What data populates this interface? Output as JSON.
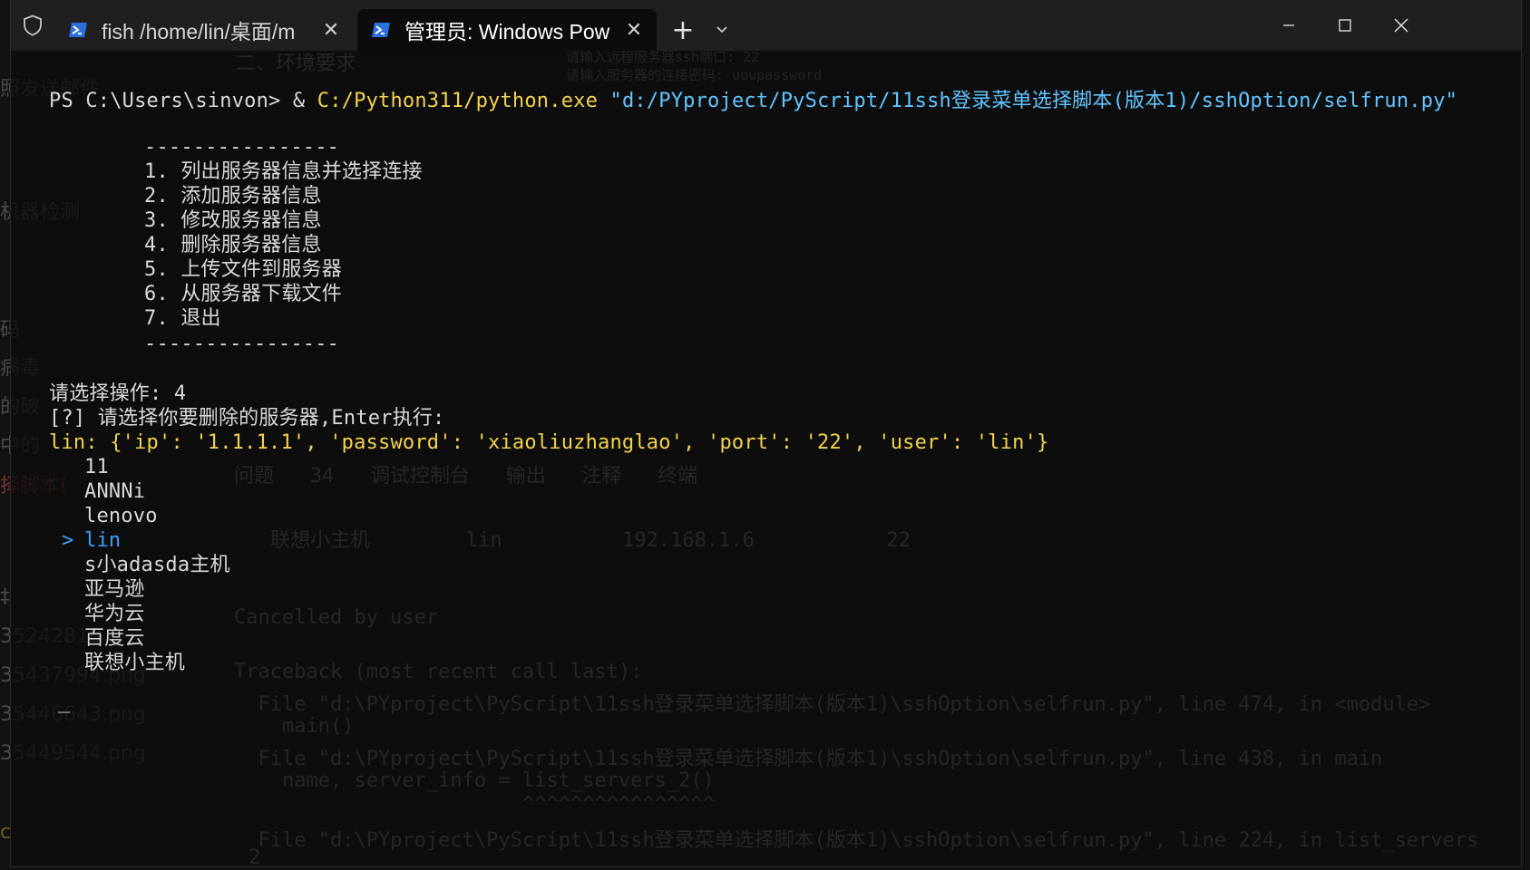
{
  "tabs": [
    {
      "title": "fish /home/lin/桌面/m",
      "icon": "powershell-icon",
      "active": false
    },
    {
      "title": "管理员: Windows Pow",
      "icon": "powershell-icon",
      "active": true
    }
  ],
  "titlebar": {
    "new_tab": "+",
    "close_glyph": "✕"
  },
  "terminal": {
    "prompt": "PS C:\\Users\\sinvon> & ",
    "exe": "C:/Python311/python.exe",
    "script": "\"d:/PYproject/PyScript/11ssh登录菜单选择脚本(版本1)/sshOption/selfrun.py\"",
    "separator": "----------------",
    "menu": [
      "1. 列出服务器信息并选择连接",
      "2. 添加服务器信息",
      "3. 修改服务器信息",
      "4. 删除服务器信息",
      "5. 上传文件到服务器",
      "6. 从服务器下载文件",
      "7. 退出"
    ],
    "choose_prompt": "请选择操作: 4",
    "delete_prompt": "[?] 请选择你要删除的服务器,Enter执行:",
    "server_info": "lin: {'ip': '1.1.1.1', 'password': 'xiaoliuzhanglao', 'port': '22', 'user': 'lin'}",
    "servers": [
      "11",
      "ANNNi",
      "lenovo",
      "lin",
      "s小adasda主机",
      "亚马逊",
      "华为云",
      "百度云",
      "联想小主机"
    ],
    "selected_marker": ">",
    "cursor": "_"
  },
  "background": {
    "left_fragments": [
      "照发送邮件",
      "机器检测",
      "码",
      "病毒",
      "的破",
      "中的",
      "择脚本(",
      "‡",
      "35242818",
      "35437994.png",
      "35446643.png",
      "35449544.png",
      "c"
    ],
    "editor_faint": {
      "env": "二、环境要求",
      "ssh_port": "请输入远程服务器ssh端口: 22",
      "ssh_pwd": "请输入服务器的连接密码: uuupassword",
      "tabs_label": "问题   34   调试控制台   输出   注释   终端",
      "table_row": "联想小主机        lin          192.168.1.6           22",
      "cancelled": "Cancelled by user",
      "traceback": "Traceback (most recent call last):",
      "file1": "  File \"d:\\PYproject\\PyScript\\11ssh登录菜单选择脚本(版本1)\\sshOption\\selfrun.py\", line 474, in <module>",
      "main": "    main()",
      "file2": "  File \"d:\\PYproject\\PyScript\\11ssh登录菜单选择脚本(版本1)\\sshOption\\selfrun.py\", line 438, in main",
      "name_line": "    name, server_info = list_servers_2()",
      "carets": "                        ^^^^^^^^^^^^^^^^",
      "file3": "  File \"d:\\PYproject\\PyScript\\11ssh登录菜单选择脚本(版本1)\\sshOption\\selfrun.py\", line 224, in list_servers",
      "bottom": "2"
    }
  },
  "colors": {
    "titlebar": "#1f1f1f",
    "terminal_bg": "#0c0c0c",
    "yellow": "#f3d24c",
    "blue": "#3b9fff",
    "text": "#d8d8d8"
  }
}
